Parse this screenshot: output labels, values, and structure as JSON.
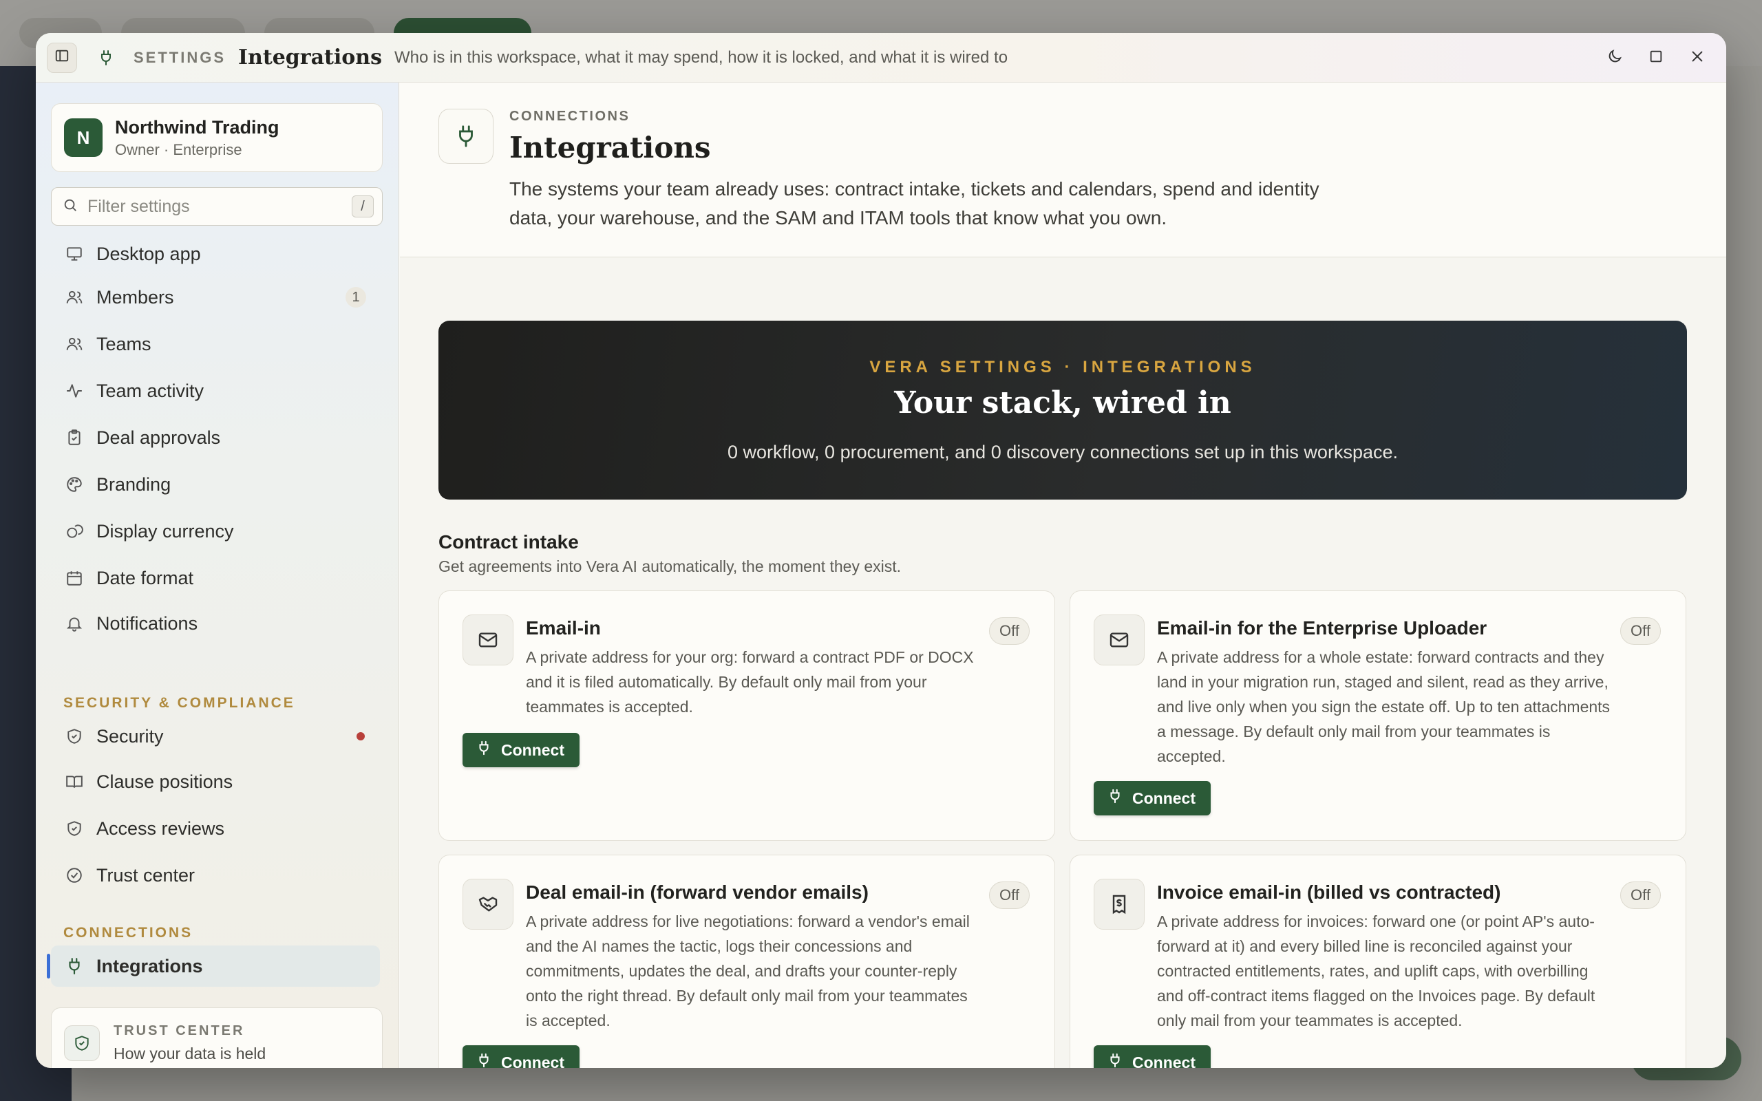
{
  "titlebar": {
    "section": "SETTINGS",
    "title": "Integrations",
    "subtitle": "Who is in this workspace, what it may spend, how it is locked, and what it is wired to"
  },
  "org": {
    "initial": "N",
    "name": "Northwind Trading",
    "role": "Owner · Enterprise"
  },
  "filter": {
    "placeholder": "Filter settings",
    "shortcut": "/"
  },
  "nav": {
    "items": [
      {
        "label": "Desktop app",
        "icon": "monitor-icon"
      },
      {
        "label": "Members",
        "icon": "users-icon",
        "badge": "1"
      },
      {
        "label": "Teams",
        "icon": "users-icon"
      },
      {
        "label": "Team activity",
        "icon": "activity-icon"
      },
      {
        "label": "Deal approvals",
        "icon": "clipboard-check-icon"
      },
      {
        "label": "Branding",
        "icon": "palette-icon"
      },
      {
        "label": "Display currency",
        "icon": "coins-icon"
      },
      {
        "label": "Date format",
        "icon": "calendar-icon"
      },
      {
        "label": "Notifications",
        "icon": "bell-icon"
      }
    ],
    "security_heading": "SECURITY & COMPLIANCE",
    "security_items": [
      {
        "label": "Security",
        "icon": "shield-check-icon"
      },
      {
        "label": "Clause positions",
        "icon": "book-open-icon"
      },
      {
        "label": "Access reviews",
        "icon": "shield-check-icon"
      },
      {
        "label": "Trust center",
        "icon": "circle-check-icon"
      }
    ],
    "connections_heading": "CONNECTIONS",
    "connections_items": [
      {
        "label": "Integrations",
        "icon": "plug-icon",
        "active": true
      }
    ]
  },
  "trust_card": {
    "title": "TRUST CENTER",
    "subtitle": "How your data is held"
  },
  "page": {
    "eyebrow": "CONNECTIONS",
    "title": "Integrations",
    "description": "The systems your team already uses: contract intake, tickets and calendars, spend and identity data, your warehouse, and the SAM and ITAM tools that know what you own."
  },
  "hero": {
    "eyebrow": "VERA SETTINGS · INTEGRATIONS",
    "title": "Your stack, wired in",
    "subtitle": "0 workflow, 0 procurement, and 0 discovery connections set up in this workspace."
  },
  "section": {
    "title": "Contract intake",
    "subtitle": "Get agreements into Vera AI automatically, the moment they exist."
  },
  "cards": [
    {
      "title": "Email-in",
      "status": "Off",
      "description": "A private address for your org: forward a contract PDF or DOCX and it is filed automatically. By default only mail from your teammates is accepted.",
      "button": "Connect",
      "icon": "mail-icon"
    },
    {
      "title": "Email-in for the Enterprise Uploader",
      "status": "Off",
      "description": "A private address for a whole estate: forward contracts and they land in your migration run, staged and silent, read as they arrive, and live only when you sign the estate off. Up to ten attachments a message. By default only mail from your teammates is accepted.",
      "button": "Connect",
      "icon": "mail-icon"
    },
    {
      "title": "Deal email-in (forward vendor emails)",
      "status": "Off",
      "description": "A private address for live negotiations: forward a vendor's email and the AI names the tactic, logs their concessions and commitments, updates the deal, and drafts your counter-reply onto the right thread. By default only mail from your teammates is accepted.",
      "button": "Connect",
      "icon": "handshake-icon"
    },
    {
      "title": "Invoice email-in (billed vs contracted)",
      "status": "Off",
      "description": "A private address for invoices: forward one (or point AP's auto-forward at it) and every billed line is reconciled against your contracted entitlements, rates, and uplift caps, with overbilling and off-contract items flagged on the Invoices page. By default only mail from your teammates is accepted.",
      "button": "Connect",
      "icon": "receipt-icon"
    }
  ],
  "colors": {
    "accent": "#2b5a37",
    "gold": "#d9a640",
    "active_bar": "#3b6fd6",
    "alert_dot": "#b8403a"
  }
}
